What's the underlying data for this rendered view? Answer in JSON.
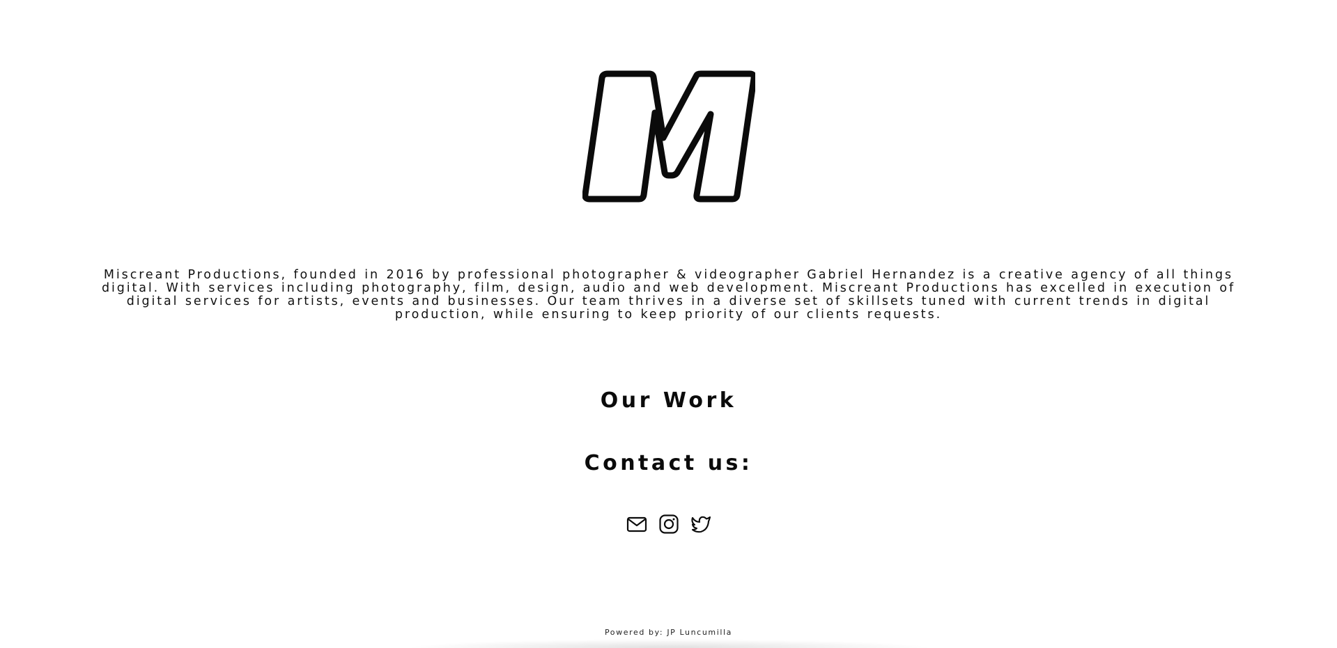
{
  "logo": {
    "letter": "M",
    "icon": "miscreant-m-logo"
  },
  "about": {
    "text": "Miscreant Productions, founded in 2016 by professional photographer & videographer Gabriel Hernandez is a creative agency of all things digital. With services including photography, film, design, audio and web development. Miscreant Productions has excelled in execution of digital services for artists, events and businesses. Our team thrives in a diverse set of skillsets tuned with current trends in digital production, while ensuring to keep priority of our clients requests."
  },
  "nav": {
    "our_work": "Our Work",
    "contact": "Contact us:"
  },
  "social": [
    {
      "icon": "email-icon"
    },
    {
      "icon": "instagram-icon"
    },
    {
      "icon": "twitter-icon"
    }
  ],
  "footer": {
    "powered_by": "Powered by: JP Luncumilla"
  },
  "colors": {
    "background": "#ffffff",
    "text": "#0b0b0b"
  }
}
